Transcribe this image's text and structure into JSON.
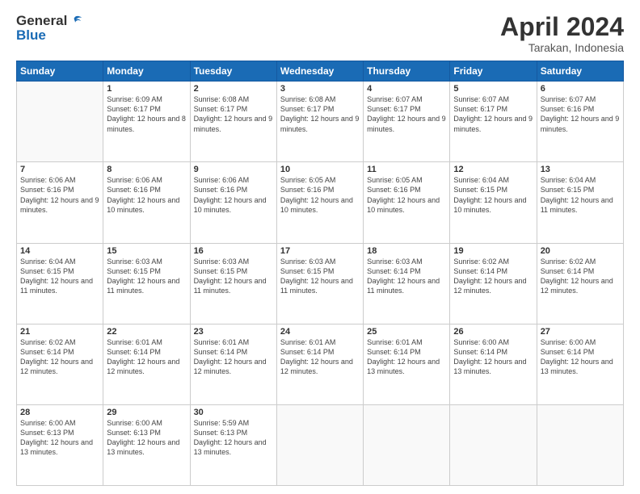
{
  "header": {
    "logo_general": "General",
    "logo_blue": "Blue",
    "month_title": "April 2024",
    "subtitle": "Tarakan, Indonesia"
  },
  "weekdays": [
    "Sunday",
    "Monday",
    "Tuesday",
    "Wednesday",
    "Thursday",
    "Friday",
    "Saturday"
  ],
  "weeks": [
    [
      {
        "day": "",
        "sunrise": "",
        "sunset": "",
        "daylight": ""
      },
      {
        "day": "1",
        "sunrise": "Sunrise: 6:09 AM",
        "sunset": "Sunset: 6:17 PM",
        "daylight": "Daylight: 12 hours and 8 minutes."
      },
      {
        "day": "2",
        "sunrise": "Sunrise: 6:08 AM",
        "sunset": "Sunset: 6:17 PM",
        "daylight": "Daylight: 12 hours and 9 minutes."
      },
      {
        "day": "3",
        "sunrise": "Sunrise: 6:08 AM",
        "sunset": "Sunset: 6:17 PM",
        "daylight": "Daylight: 12 hours and 9 minutes."
      },
      {
        "day": "4",
        "sunrise": "Sunrise: 6:07 AM",
        "sunset": "Sunset: 6:17 PM",
        "daylight": "Daylight: 12 hours and 9 minutes."
      },
      {
        "day": "5",
        "sunrise": "Sunrise: 6:07 AM",
        "sunset": "Sunset: 6:17 PM",
        "daylight": "Daylight: 12 hours and 9 minutes."
      },
      {
        "day": "6",
        "sunrise": "Sunrise: 6:07 AM",
        "sunset": "Sunset: 6:16 PM",
        "daylight": "Daylight: 12 hours and 9 minutes."
      }
    ],
    [
      {
        "day": "7",
        "sunrise": "Sunrise: 6:06 AM",
        "sunset": "Sunset: 6:16 PM",
        "daylight": "Daylight: 12 hours and 9 minutes."
      },
      {
        "day": "8",
        "sunrise": "Sunrise: 6:06 AM",
        "sunset": "Sunset: 6:16 PM",
        "daylight": "Daylight: 12 hours and 10 minutes."
      },
      {
        "day": "9",
        "sunrise": "Sunrise: 6:06 AM",
        "sunset": "Sunset: 6:16 PM",
        "daylight": "Daylight: 12 hours and 10 minutes."
      },
      {
        "day": "10",
        "sunrise": "Sunrise: 6:05 AM",
        "sunset": "Sunset: 6:16 PM",
        "daylight": "Daylight: 12 hours and 10 minutes."
      },
      {
        "day": "11",
        "sunrise": "Sunrise: 6:05 AM",
        "sunset": "Sunset: 6:16 PM",
        "daylight": "Daylight: 12 hours and 10 minutes."
      },
      {
        "day": "12",
        "sunrise": "Sunrise: 6:04 AM",
        "sunset": "Sunset: 6:15 PM",
        "daylight": "Daylight: 12 hours and 10 minutes."
      },
      {
        "day": "13",
        "sunrise": "Sunrise: 6:04 AM",
        "sunset": "Sunset: 6:15 PM",
        "daylight": "Daylight: 12 hours and 11 minutes."
      }
    ],
    [
      {
        "day": "14",
        "sunrise": "Sunrise: 6:04 AM",
        "sunset": "Sunset: 6:15 PM",
        "daylight": "Daylight: 12 hours and 11 minutes."
      },
      {
        "day": "15",
        "sunrise": "Sunrise: 6:03 AM",
        "sunset": "Sunset: 6:15 PM",
        "daylight": "Daylight: 12 hours and 11 minutes."
      },
      {
        "day": "16",
        "sunrise": "Sunrise: 6:03 AM",
        "sunset": "Sunset: 6:15 PM",
        "daylight": "Daylight: 12 hours and 11 minutes."
      },
      {
        "day": "17",
        "sunrise": "Sunrise: 6:03 AM",
        "sunset": "Sunset: 6:15 PM",
        "daylight": "Daylight: 12 hours and 11 minutes."
      },
      {
        "day": "18",
        "sunrise": "Sunrise: 6:03 AM",
        "sunset": "Sunset: 6:14 PM",
        "daylight": "Daylight: 12 hours and 11 minutes."
      },
      {
        "day": "19",
        "sunrise": "Sunrise: 6:02 AM",
        "sunset": "Sunset: 6:14 PM",
        "daylight": "Daylight: 12 hours and 12 minutes."
      },
      {
        "day": "20",
        "sunrise": "Sunrise: 6:02 AM",
        "sunset": "Sunset: 6:14 PM",
        "daylight": "Daylight: 12 hours and 12 minutes."
      }
    ],
    [
      {
        "day": "21",
        "sunrise": "Sunrise: 6:02 AM",
        "sunset": "Sunset: 6:14 PM",
        "daylight": "Daylight: 12 hours and 12 minutes."
      },
      {
        "day": "22",
        "sunrise": "Sunrise: 6:01 AM",
        "sunset": "Sunset: 6:14 PM",
        "daylight": "Daylight: 12 hours and 12 minutes."
      },
      {
        "day": "23",
        "sunrise": "Sunrise: 6:01 AM",
        "sunset": "Sunset: 6:14 PM",
        "daylight": "Daylight: 12 hours and 12 minutes."
      },
      {
        "day": "24",
        "sunrise": "Sunrise: 6:01 AM",
        "sunset": "Sunset: 6:14 PM",
        "daylight": "Daylight: 12 hours and 12 minutes."
      },
      {
        "day": "25",
        "sunrise": "Sunrise: 6:01 AM",
        "sunset": "Sunset: 6:14 PM",
        "daylight": "Daylight: 12 hours and 13 minutes."
      },
      {
        "day": "26",
        "sunrise": "Sunrise: 6:00 AM",
        "sunset": "Sunset: 6:14 PM",
        "daylight": "Daylight: 12 hours and 13 minutes."
      },
      {
        "day": "27",
        "sunrise": "Sunrise: 6:00 AM",
        "sunset": "Sunset: 6:14 PM",
        "daylight": "Daylight: 12 hours and 13 minutes."
      }
    ],
    [
      {
        "day": "28",
        "sunrise": "Sunrise: 6:00 AM",
        "sunset": "Sunset: 6:13 PM",
        "daylight": "Daylight: 12 hours and 13 minutes."
      },
      {
        "day": "29",
        "sunrise": "Sunrise: 6:00 AM",
        "sunset": "Sunset: 6:13 PM",
        "daylight": "Daylight: 12 hours and 13 minutes."
      },
      {
        "day": "30",
        "sunrise": "Sunrise: 5:59 AM",
        "sunset": "Sunset: 6:13 PM",
        "daylight": "Daylight: 12 hours and 13 minutes."
      },
      {
        "day": "",
        "sunrise": "",
        "sunset": "",
        "daylight": ""
      },
      {
        "day": "",
        "sunrise": "",
        "sunset": "",
        "daylight": ""
      },
      {
        "day": "",
        "sunrise": "",
        "sunset": "",
        "daylight": ""
      },
      {
        "day": "",
        "sunrise": "",
        "sunset": "",
        "daylight": ""
      }
    ]
  ]
}
